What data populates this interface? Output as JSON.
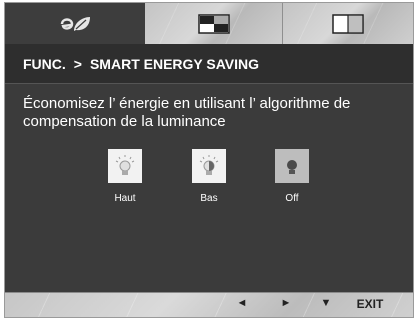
{
  "tabs": [
    {
      "icon": "eco-icon"
    },
    {
      "icon": "picture-icon"
    },
    {
      "icon": "split-screen-icon"
    }
  ],
  "header": {
    "func": "FUNC.",
    "separator": ">",
    "title": "SMART ENERGY SAVING"
  },
  "description": "Économisez l’ énergie en utilisant l’ algorithme de compensation de la luminance",
  "options": [
    {
      "label": "Haut",
      "icon": "bulb-high-icon",
      "selected": false
    },
    {
      "label": "Bas",
      "icon": "bulb-low-icon",
      "selected": false
    },
    {
      "label": "Off",
      "icon": "bulb-off-icon",
      "selected": true
    }
  ],
  "footer": {
    "left": "◄",
    "right": "►",
    "down": "▼",
    "exit": "EXIT"
  }
}
